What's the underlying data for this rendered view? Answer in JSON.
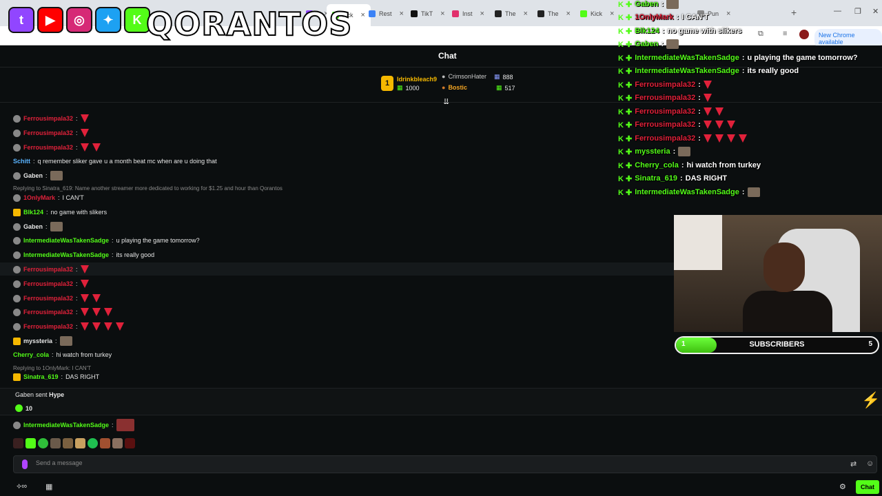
{
  "browser": {
    "tabs": [
      {
        "label": "",
        "icon": "twitch-icon",
        "color": "#9146ff"
      },
      {
        "label": "kick",
        "icon": "kick-icon",
        "color": "#53fc18"
      },
      {
        "label": "Rest",
        "icon": "r-icon",
        "color": "#3b82f6"
      },
      {
        "label": "TikT",
        "icon": "tiktok-icon",
        "color": "#111111"
      },
      {
        "label": "Inst",
        "icon": "instagram-icon",
        "color": "#e1306c"
      },
      {
        "label": "The",
        "icon": "github-icon",
        "color": "#222222"
      },
      {
        "label": "The",
        "icon": "github-icon",
        "color": "#222222"
      },
      {
        "label": "Kick",
        "icon": "kick-icon",
        "color": "#53fc18"
      },
      {
        "label": "Pun",
        "icon": "page-icon",
        "color": "#888888"
      }
    ],
    "new_chrome": "New Chrome available"
  },
  "overlay": {
    "brand": "QORANTOS",
    "socials": [
      {
        "icon": "twitch-icon",
        "glyph": "t",
        "color": "#9146ff"
      },
      {
        "icon": "youtube-icon",
        "glyph": "▶",
        "color": "#ff0000"
      },
      {
        "icon": "instagram-icon",
        "glyph": "◎",
        "color": "#d62976"
      },
      {
        "icon": "twitter-icon",
        "glyph": "✦",
        "color": "#1da1f2"
      },
      {
        "icon": "kick-icon",
        "glyph": "K",
        "color": "#53fc18"
      }
    ]
  },
  "chat": {
    "title": "Chat",
    "leaderboard": {
      "rank": "1",
      "first_user": "Idrinkbleach9",
      "first_amount": "1000",
      "second_user": "CrimsonHater",
      "second_amount": "888",
      "third_user": "Bostic",
      "third_amount": "517"
    },
    "messages": [
      {
        "user": "Ferrousimpala32",
        "color": "#e0213a",
        "text": "",
        "melons": 1
      },
      {
        "user": "Ferrousimpala32",
        "color": "#e0213a",
        "text": "",
        "melons": 1
      },
      {
        "user": "Ferrousimpala32",
        "color": "#e0213a",
        "text": "",
        "melons": 2
      },
      {
        "user": "Schitt",
        "color": "#5ab4ff",
        "text": "q remember sliker gave u a month beat mc when are u doing that",
        "melons": 0
      },
      {
        "user": "Gaben",
        "color": "#e8e8e8",
        "text": "",
        "melons": 0
      },
      {
        "user": "1OnlyMark",
        "color": "#e0213a",
        "text": "I CAN'T",
        "melons": 0
      },
      {
        "user": "Blk124",
        "color": "#53fc18",
        "text": "no game with slikers",
        "melons": 0
      },
      {
        "user": "Gaben",
        "color": "#e8e8e8",
        "text": "",
        "melons": 0
      },
      {
        "user": "IntermediateWasTakenSadge",
        "color": "#53fc18",
        "text": "u playing the game tomorrow?",
        "melons": 0
      },
      {
        "user": "IntermediateWasTakenSadge",
        "color": "#53fc18",
        "text": "its really good",
        "melons": 0
      },
      {
        "user": "Ferrousimpala32",
        "color": "#e0213a",
        "text": "",
        "melons": 1
      },
      {
        "user": "Ferrousimpala32",
        "color": "#e0213a",
        "text": "",
        "melons": 1
      },
      {
        "user": "Ferrousimpala32",
        "color": "#e0213a",
        "text": "",
        "melons": 2
      },
      {
        "user": "Ferrousimpala32",
        "color": "#e0213a",
        "text": "",
        "melons": 3
      },
      {
        "user": "Ferrousimpala32",
        "color": "#e0213a",
        "text": "",
        "melons": 4
      },
      {
        "user": "myssteria",
        "color": "#e8e8e8",
        "text": "",
        "melons": 0
      },
      {
        "user": "Cherry_cola",
        "color": "#53fc18",
        "text": "hi watch from turkey",
        "melons": 0
      },
      {
        "user": "Sinatra_619",
        "color": "#53fc18",
        "text": "DAS RIGHT",
        "melons": 0
      }
    ],
    "reply_1": "Replying to Sinatra_619: Name another streamer more dedicated to working for $1.25 and hour than Qorantos",
    "reply_2": "Replying to 1OnlyMark: I CAN'T",
    "hype": {
      "user": "Gaben",
      "sent": "sent",
      "label": "Hype",
      "amount": "10"
    },
    "pinned_user": "IntermediateWasTakenSadge",
    "input_placeholder": "Send a message",
    "chat_button": "Chat"
  },
  "stream_overlay": {
    "messages": [
      {
        "user": "Gaben",
        "text": ""
      },
      {
        "user": "1OnlyMark",
        "text": "I CAN'T"
      },
      {
        "user": "Blk124",
        "text": "no game with slikers"
      },
      {
        "user": "Gaben",
        "text": ""
      },
      {
        "user": "IntermediateWasTakenSadge",
        "text": "u playing the game tomorrow?"
      },
      {
        "user": "IntermediateWasTakenSadge",
        "text": "its really good"
      },
      {
        "user": "Ferrousimpala32",
        "text": "",
        "melons": 1
      },
      {
        "user": "Ferrousimpala32",
        "text": "",
        "melons": 1
      },
      {
        "user": "Ferrousimpala32",
        "text": "",
        "melons": 2
      },
      {
        "user": "Ferrousimpala32",
        "text": "",
        "melons": 3
      },
      {
        "user": "Ferrousimpala32",
        "text": "",
        "melons": 4
      },
      {
        "user": "myssteria",
        "text": ""
      },
      {
        "user": "Cherry_cola",
        "text": "hi watch from turkey"
      },
      {
        "user": "Sinatra_619",
        "text": "DAS RIGHT"
      },
      {
        "user": "IntermediateWasTakenSadge",
        "text": ""
      }
    ],
    "sub_goal": {
      "label": "SUBSCRIBERS",
      "current": "1",
      "target": "5",
      "progress": 0.2
    }
  },
  "colors": {
    "kick_green": "#53fc18",
    "red_user": "#e0213a"
  }
}
